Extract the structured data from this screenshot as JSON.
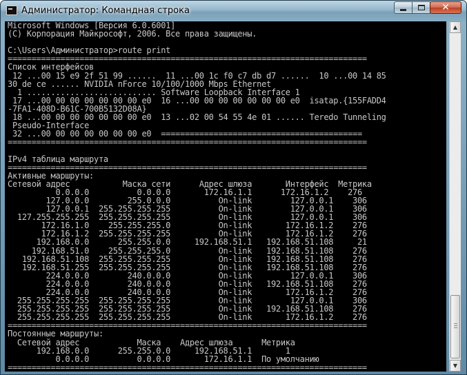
{
  "window": {
    "title": "Администратор: Командная строка",
    "icon": "cmd-icon",
    "controls": {
      "minimize": "minimize-icon",
      "maximize": "maximize-icon",
      "close": "✕"
    }
  },
  "console": {
    "lines": [
      "Microsoft Windows [Версия 6.0.6001]",
      "(C) Корпорация Майкрософт, 2006. Все права защищены.",
      "",
      "C:\\Users\\Администратор>route print",
      "===========================================================================",
      "Список интерфейсов",
      " 12 ...00 15 e9 2f 51 99 ......  11 ...00 1c f0 c7 db d7 ......  10 ...00 14 85",
      "30 de ce ...... NVIDIA nForce 10/100/1000 Mbps Ethernet",
      "  1 ........................... Software Loopback Interface 1",
      " 17 ...00 00 00 00 00 00 00 e0  16 ...00 00 00 00 00 00 00 e0  isatap.{155FADD4",
      "-7FA1-408D-B61C-700B5132D08A}",
      " 18 ...00 00 00 00 00 00 00 e0  13 ...02 00 54 55 4e 01 ...... Teredo Tunneling",
      " Pseudo-Interface",
      " 32 ...00 00 00 00 00 00 00 e0  ==========================================",
      "===========================================================================",
      "",
      "IPv4 таблица маршрута",
      "===========================================================================",
      "Активные маршруты:",
      "Сетевой адрес           Маска сети      Адрес шлюза       Интерфейс  Метрика",
      "          0.0.0.0          0.0.0.0       172.16.1.1      172.16.1.2    276",
      "        127.0.0.0        255.0.0.0          On-link        127.0.0.1    306",
      "        127.0.0.1  255.255.255.255          On-link        127.0.0.1    306",
      "  127.255.255.255  255.255.255.255          On-link        127.0.0.1    306",
      "       172.16.1.0    255.255.255.0          On-link       172.16.1.2    276",
      "       172.16.1.2  255.255.255.255          On-link       172.16.1.2    276",
      "      192.168.0.0      255.255.0.0     192.168.51.1   192.168.51.108     21",
      "     192.168.51.0    255.255.255.0          On-link   192.168.51.108    276",
      "   192.168.51.108  255.255.255.255          On-link   192.168.51.108    276",
      "   192.168.51.255  255.255.255.255          On-link   192.168.51.108    276",
      "        224.0.0.0        240.0.0.0          On-link        127.0.0.1    306",
      "        224.0.0.0        240.0.0.0          On-link   192.168.51.108    276",
      "        224.0.0.0        240.0.0.0          On-link       172.16.1.2    276",
      "  255.255.255.255  255.255.255.255          On-link        127.0.0.1    306",
      "  255.255.255.255  255.255.255.255          On-link   192.168.51.108    276",
      "  255.255.255.255  255.255.255.255          On-link       172.16.1.2    276",
      "===========================================================================",
      "Постоянные маршруты:",
      "  Сетевой адрес            Маска    Адрес шлюза      Метрика",
      "      192.168.0.0      255.255.0.0     192.168.51.1       1",
      "          0.0.0.0          0.0.0.0       172.16.1.1  По умолчанию",
      "==========================================================================="
    ]
  },
  "scrollbar": {
    "up": "▲",
    "down": "▼"
  }
}
